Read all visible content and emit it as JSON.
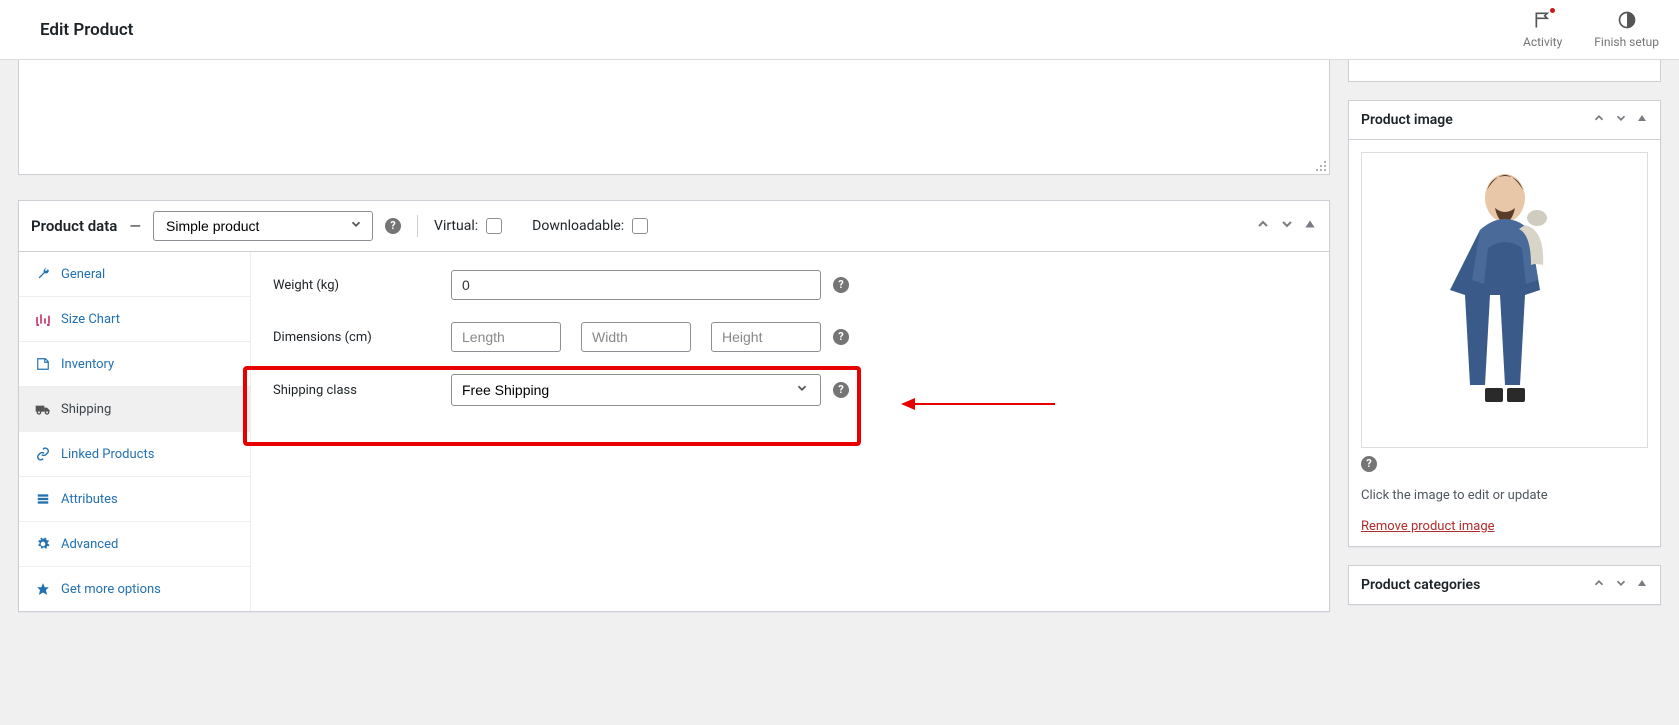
{
  "topbar": {
    "title": "Edit Product",
    "activity": "Activity",
    "finish": "Finish setup"
  },
  "product_data": {
    "heading": "Product data",
    "type_selected": "Simple product",
    "virtual_label": "Virtual:",
    "downloadable_label": "Downloadable:"
  },
  "tabs": {
    "general": "General",
    "size_chart": "Size Chart",
    "inventory": "Inventory",
    "shipping": "Shipping",
    "linked": "Linked Products",
    "attributes": "Attributes",
    "advanced": "Advanced",
    "get_more": "Get more options"
  },
  "shipping_fields": {
    "weight_label": "Weight (kg)",
    "weight_value": "0",
    "dimensions_label": "Dimensions (cm)",
    "length_ph": "Length",
    "width_ph": "Width",
    "height_ph": "Height",
    "class_label": "Shipping class",
    "class_value": "Free Shipping"
  },
  "sidebar": {
    "product_image": {
      "title": "Product image",
      "caption": "Click the image to edit or update",
      "remove": "Remove product image"
    },
    "categories": {
      "title": "Product categories"
    }
  },
  "help_glyph": "?"
}
